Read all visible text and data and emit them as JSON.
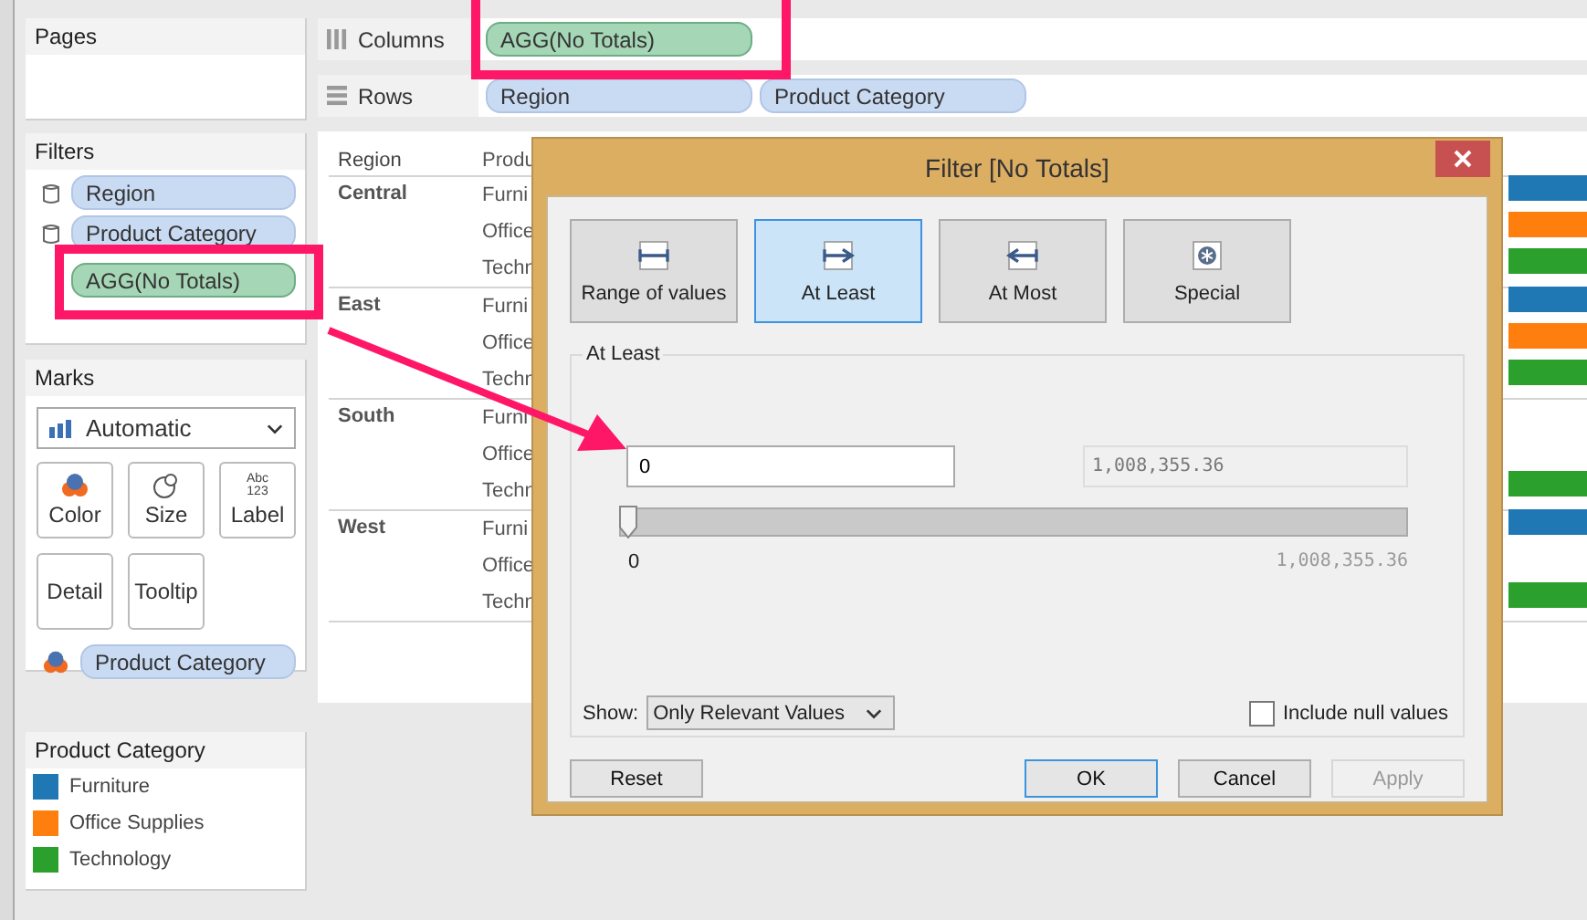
{
  "pages_card": {
    "title": "Pages"
  },
  "filters_card": {
    "title": "Filters",
    "items": [
      {
        "label": "Region",
        "kind": "dimension"
      },
      {
        "label": "Product Category",
        "kind": "dimension"
      },
      {
        "label": "AGG(No Totals)",
        "kind": "measure"
      }
    ]
  },
  "marks_card": {
    "title": "Marks",
    "mark_type": "Automatic",
    "buttons": [
      {
        "label": "Color",
        "kind": "color"
      },
      {
        "label": "Size",
        "kind": "size"
      },
      {
        "label": "Label",
        "kind": "label",
        "icon_lines": [
          "Abc",
          "123"
        ]
      },
      {
        "label": "Detail",
        "kind": "detail"
      },
      {
        "label": "Tooltip",
        "kind": "tooltip"
      }
    ],
    "field": {
      "label": "Product Category",
      "kind": "color"
    }
  },
  "legend": {
    "title": "Product Category",
    "items": [
      {
        "label": "Furniture",
        "color": "#1f77b4"
      },
      {
        "label": "Office Supplies",
        "color": "#ff7f0e"
      },
      {
        "label": "Technology",
        "color": "#2ca02c"
      }
    ]
  },
  "columns_shelf": {
    "label": "Columns",
    "pills": [
      {
        "label": "AGG(No Totals)",
        "kind": "measure"
      }
    ]
  },
  "rows_shelf": {
    "label": "Rows",
    "pills": [
      {
        "label": "Region",
        "kind": "dimension"
      },
      {
        "label": "Product Category",
        "kind": "dimension"
      }
    ]
  },
  "table": {
    "columns": [
      "Region",
      "Produ"
    ],
    "groups": [
      {
        "region": "Central",
        "rows": [
          {
            "category": "Furni",
            "color": "#1f77b4"
          },
          {
            "category": "Office",
            "color": "#ff7f0e"
          },
          {
            "category": "Techn",
            "color": "#2ca02c"
          }
        ]
      },
      {
        "region": "East",
        "rows": [
          {
            "category": "Furni",
            "color": "#1f77b4"
          },
          {
            "category": "Office",
            "color": "#ff7f0e"
          },
          {
            "category": "Techn",
            "color": "#2ca02c"
          }
        ]
      },
      {
        "region": "South",
        "rows": [
          {
            "category": "Furni"
          },
          {
            "category": "Office"
          },
          {
            "category": "Techn",
            "color": "#2ca02c"
          }
        ]
      },
      {
        "region": "West",
        "rows": [
          {
            "category": "Furni",
            "color": "#1f77b4"
          },
          {
            "category": "Office"
          },
          {
            "category": "Techn",
            "color": "#2ca02c"
          }
        ]
      }
    ]
  },
  "dialog": {
    "title": "Filter [No Totals]",
    "modes": [
      {
        "label": "Range of values",
        "kind": "range",
        "selected": false
      },
      {
        "label": "At Least",
        "kind": "at_least",
        "selected": true
      },
      {
        "label": "At Most",
        "kind": "at_most",
        "selected": false
      },
      {
        "label": "Special",
        "kind": "special",
        "selected": false
      }
    ],
    "group_title": "At Least",
    "value": "0",
    "max_value": "1,008,355.36",
    "slider": {
      "level": 0,
      "min_label": "0",
      "max_label": "1,008,355.36"
    },
    "show_label": "Show:",
    "show_value": "Only Relevant Values",
    "include_null": {
      "label": "Include null values",
      "checked": false
    },
    "buttons": [
      {
        "label": "Reset",
        "default": false,
        "disabled": false
      },
      {
        "label": "OK",
        "default": true,
        "disabled": false
      },
      {
        "label": "Cancel",
        "default": false,
        "disabled": false
      },
      {
        "label": "Apply",
        "default": false,
        "disabled": true
      }
    ]
  }
}
